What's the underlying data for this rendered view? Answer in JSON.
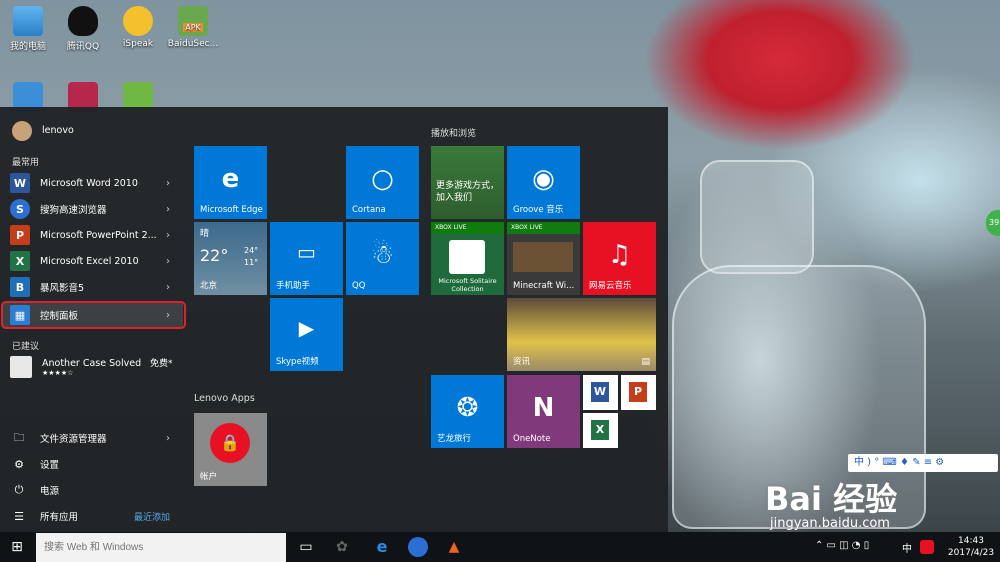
{
  "desktop": {
    "icons": [
      {
        "label": "我的电脑",
        "icon": "computer-icon"
      },
      {
        "label": "腾讯QQ",
        "icon": "qq-icon"
      },
      {
        "label": "iSpeak",
        "icon": "ispeak-icon"
      },
      {
        "label": "BaiduSec...",
        "icon": "apk-icon",
        "badge": "APK"
      }
    ],
    "side_badge": "39"
  },
  "start_menu": {
    "user": "lenovo",
    "most_used_header": "最常用",
    "most_used": [
      {
        "label": "Microsoft Word 2010",
        "icon": "word-icon",
        "glyph": "W",
        "color": "#2b579a"
      },
      {
        "label": "搜狗高速浏览器",
        "icon": "sogou-browser-icon",
        "glyph": "S",
        "color": "#2a6fd1"
      },
      {
        "label": "Microsoft PowerPoint 2...",
        "icon": "powerpoint-icon",
        "glyph": "P",
        "color": "#c43e1c"
      },
      {
        "label": "Microsoft Excel 2010",
        "icon": "excel-icon",
        "glyph": "X",
        "color": "#217346"
      },
      {
        "label": "暴风影音5",
        "icon": "baofeng-icon",
        "glyph": "B",
        "color": "#1f6fb8"
      },
      {
        "label": "控制面板",
        "icon": "control-panel-icon",
        "glyph": "▦",
        "color": "#2d7dd2"
      }
    ],
    "suggested_header": "已建议",
    "suggested": {
      "title": "Another Case Solved",
      "price": "免费*",
      "stars": "★★★★☆"
    },
    "bottom": [
      {
        "label": "文件资源管理器",
        "icon": "folder-icon",
        "glyph": "🗀"
      },
      {
        "label": "设置",
        "icon": "gear-icon",
        "glyph": "⚙"
      },
      {
        "label": "电源",
        "icon": "power-icon",
        "glyph": "⏻"
      },
      {
        "label": "所有应用",
        "icon": "list-icon",
        "glyph": "☰"
      }
    ],
    "new_label": "最近添加",
    "group_play": "播放和浏览",
    "group_lenovo": "Lenovo Apps",
    "tiles": {
      "edge": "Microsoft Edge",
      "cortana": "Cortana",
      "weather_condition": "晴",
      "weather_temp": "22°",
      "weather_high": "24°",
      "weather_low": "11°",
      "weather_city": "北京",
      "phone": "手机助手",
      "qq": "QQ",
      "skype": "Skype视频",
      "xbox": "更多游戏方式，加入我们",
      "groove": "Groove 音乐",
      "xbox_live": "XBOX LIVE",
      "solitaire": "Microsoft Solitaire Collection",
      "minecraft": "Minecraft Wi...",
      "netease": "网易云音乐",
      "news": "资讯",
      "elong": "艺龙旅行",
      "onenote": "OneNote",
      "account": "帐户"
    }
  },
  "taskbar": {
    "search_placeholder": "搜索 Web 和 Windows",
    "ime": "中",
    "time": "14:43",
    "date": "2017/4/23"
  },
  "ime_toolbar": "中 ) ° ⌨ ♦ ✎ ≡ ⚙",
  "watermark": {
    "brand": "Bai 经验",
    "url": "jingyan.baidu.com"
  }
}
